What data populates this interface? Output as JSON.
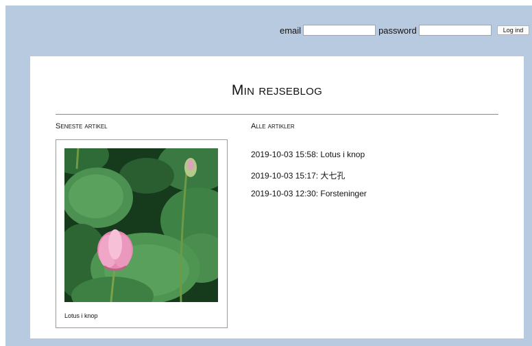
{
  "login": {
    "email_label": "email",
    "password_label": "password",
    "email_value": "",
    "password_value": "",
    "submit_label": "Log ind"
  },
  "page": {
    "title": "Min rejseblog"
  },
  "latest": {
    "heading": "Seneste artikel",
    "image_subject": "pink lotus bud among green lotus leaves",
    "caption": "Lotus i knop"
  },
  "all_articles": {
    "heading": "Alle artikler",
    "items": [
      {
        "text": "2019-10-03 15:58: Lotus i knop"
      },
      {
        "text": "2019-10-03 15:17: 大七孔"
      },
      {
        "text": "2019-10-03 12:30: Forsteninger"
      }
    ]
  },
  "colors": {
    "frame_background": "#b8cadf",
    "card_background": "#ffffff",
    "text": "#111111"
  }
}
